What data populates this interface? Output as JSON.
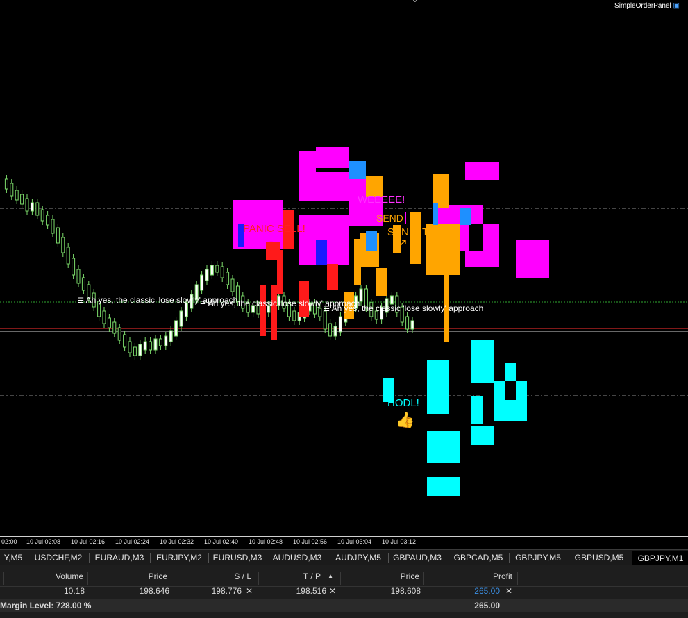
{
  "panel": {
    "label": "SimpleOrderPanel"
  },
  "annotations": {
    "panic_sell": "PANIC SELL!",
    "weeee": "WEEEEE!",
    "send_it": "SEND",
    "send_it_2": "SEND IT",
    "hodl": "HODL!",
    "lose_slowly_1": "Ah yes, the classic 'lose slowly' approach",
    "lose_slowly_2": "Ah yes, the classic 'lose slowly' approach",
    "lose_slowly_3": "Ah yes, the classic 'lose slowly' approach"
  },
  "time_axis": [
    "02:00",
    "10 Jul 02:08",
    "10 Jul 02:16",
    "10 Jul 02:24",
    "10 Jul 02:32",
    "10 Jul 02:40",
    "10 Jul 02:48",
    "10 Jul 02:56",
    "10 Jul 03:04",
    "10 Jul 03:12"
  ],
  "symbol_tabs": [
    {
      "label": "Y,M5"
    },
    {
      "label": "USDCHF,M2"
    },
    {
      "label": "EURAUD,M3"
    },
    {
      "label": "EURJPY,M2"
    },
    {
      "label": "EURUSD,M3"
    },
    {
      "label": "AUDUSD,M3"
    },
    {
      "label": "AUDJPY,M5"
    },
    {
      "label": "GBPAUD,M3"
    },
    {
      "label": "GBPCAD,M5"
    },
    {
      "label": "GBPJPY,M5"
    },
    {
      "label": "GBPUSD,M5"
    },
    {
      "label": "GBPJPY,M1",
      "active": true
    }
  ],
  "trade": {
    "headers": {
      "volume": "Volume",
      "price": "Price",
      "sl": "S / L",
      "tp": "T / P",
      "sort_arrow": "▲",
      "current_price": "Price",
      "profit": "Profit"
    },
    "row": {
      "volume": "10.18",
      "price": "198.646",
      "sl": "198.776",
      "tp": "198.516",
      "current_price": "198.608",
      "profit": "265.00"
    },
    "margin_level": "Margin Level: 728.00 %",
    "total_profit": "265.00"
  },
  "colors": {
    "bull": "#7ddc6b",
    "bear": "#ffffff",
    "magenta": "#ff00ff",
    "orange": "#ffa500",
    "cyan": "#00ffff",
    "red": "#ff1a1a",
    "blue": "#1e90ff",
    "profit_blue": "#3a8de0"
  },
  "icons": {
    "thumbs_up": "thumbs-up-icon",
    "close": "close-icon",
    "panel": "panel-icon"
  }
}
